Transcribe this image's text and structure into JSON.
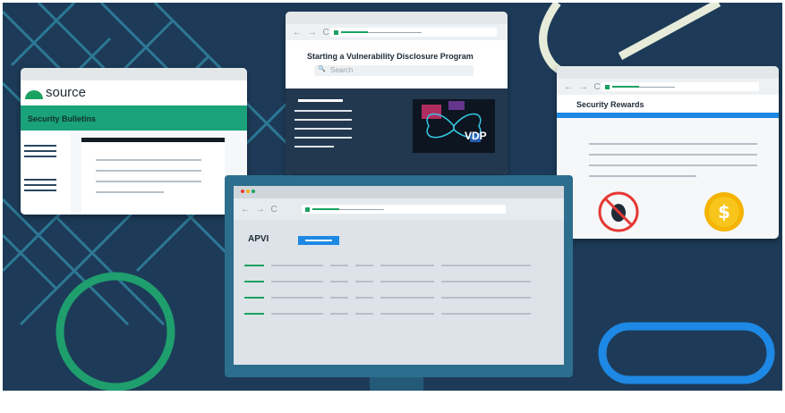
{
  "windows": {
    "source": {
      "logo_text": "source",
      "banner": "Security Bulletins"
    },
    "vdp": {
      "title": "Starting a Vulnerability Disclosure Program",
      "search_placeholder": "Search",
      "art_label": "VDP"
    },
    "rewards": {
      "title": "Security Rewards"
    },
    "monitor": {
      "title": "APVI"
    }
  },
  "nav_glyphs": "← → C",
  "search_glyph": "🔍",
  "colors": {
    "background": "#1d3b58",
    "accent_green": "#1aa260",
    "accent_blue": "#1e88e5",
    "ring_green": "#1f9e6e",
    "ring_blue": "#1e88e5"
  }
}
